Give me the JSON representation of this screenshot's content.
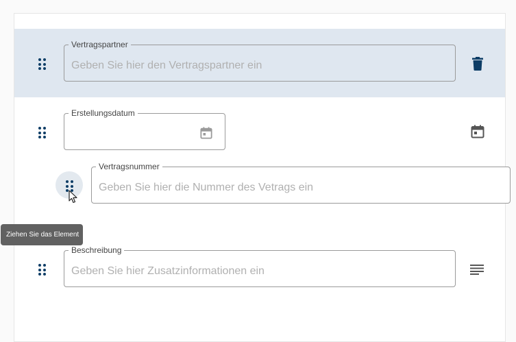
{
  "rows": [
    {
      "label": "Vertragspartner",
      "placeholder": "Geben Sie hier den Vertragspartner ein",
      "action_icon": "trash-icon"
    },
    {
      "label": "Erstellungsdatum",
      "placeholder": "",
      "action_icon": "calendar-icon"
    },
    {
      "label": "Vertragsnummer",
      "placeholder": "Geben Sie hier die Nummer des Vetrags ein",
      "action_icon": ""
    },
    {
      "label": "Beschreibung",
      "placeholder": "Geben Sie hier Zusatzinformationen ein",
      "action_icon": "notes-icon"
    }
  ],
  "tooltip": {
    "text": "Ziehen Sie das Element"
  },
  "colors": {
    "accent": "#0d3d66",
    "highlight": "#dfe7f0",
    "tooltip_bg": "#616161"
  }
}
